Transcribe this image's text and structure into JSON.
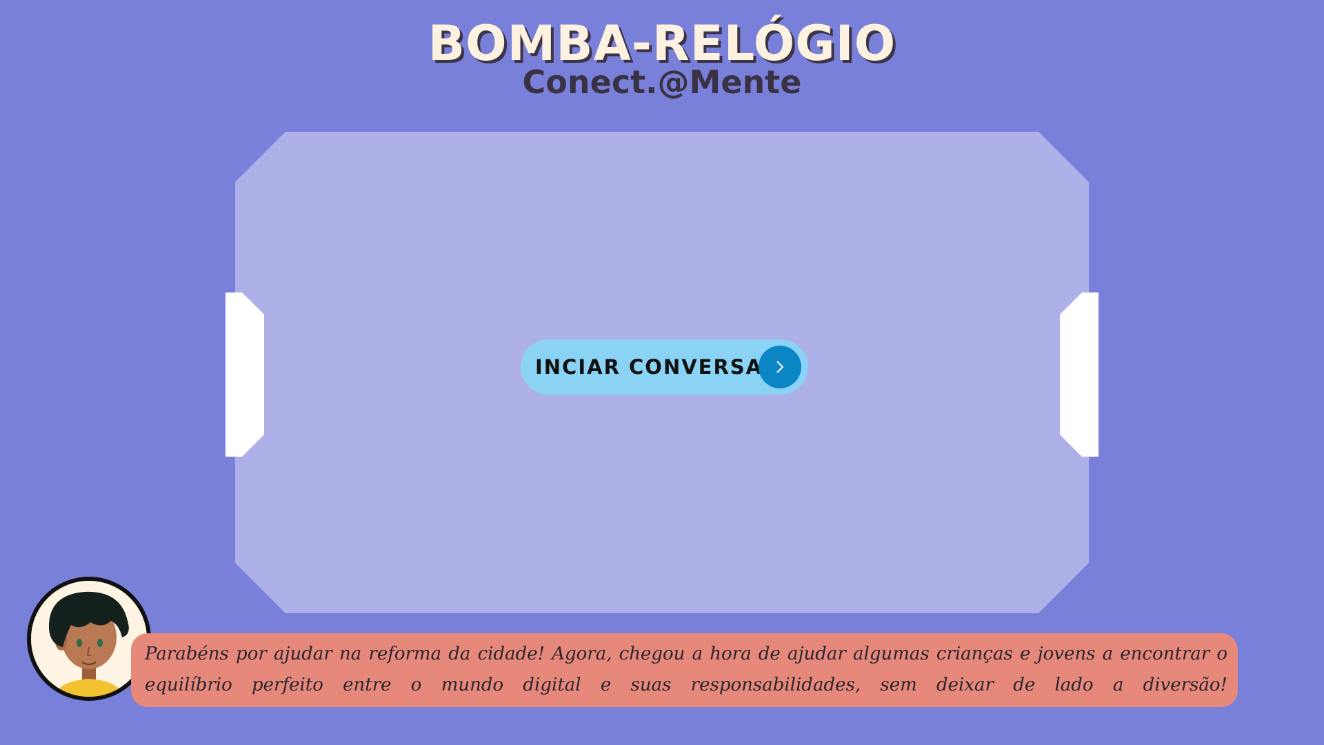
{
  "header": {
    "title": "BOMBA-RELÓGIO",
    "subtitle": "Conect.@Mente"
  },
  "start_button": {
    "label": "INCIAR CONVERSA",
    "icon": "chevron-right-icon"
  },
  "character": {
    "icon": "character-portrait"
  },
  "dialog": {
    "text": "Parabéns por ajudar na reforma da cidade! Agora, chegou a hora de ajudar algumas crianças e jovens a encontrar o equilíbrio perfeito entre o mundo digital e suas responsabilidades, sem deixar de lado a diversão!"
  },
  "colors": {
    "background": "#7880da",
    "panel": "#aeb1e8",
    "button": "#8bd3f5",
    "button_icon": "#0b86c5",
    "dialog": "#e6897a",
    "title": "#fdf1df"
  }
}
